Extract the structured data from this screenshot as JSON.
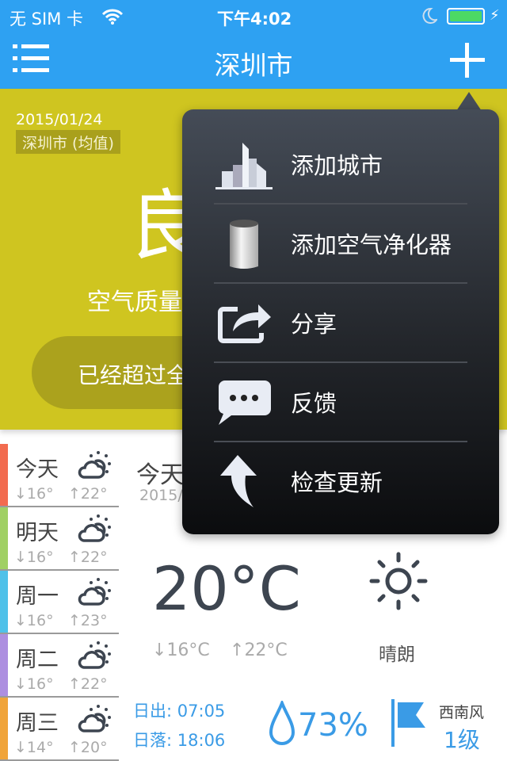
{
  "status_bar": {
    "carrier": "无 SIM 卡",
    "time": "下午4:02",
    "battery_color": "#4cd964"
  },
  "header": {
    "title": "深圳市",
    "menu_icon": "list-icon",
    "add_icon": "plus-icon"
  },
  "aqi": {
    "date": "2015/01/24",
    "location": "深圳市 (均值)",
    "level": "良",
    "description": "空气质量",
    "ranking": "已经超过全",
    "color": "#cfc520"
  },
  "menu": {
    "items": [
      {
        "label": "添加城市",
        "icon": "city-buildings-icon"
      },
      {
        "label": "添加空气净化器",
        "icon": "air-purifier-icon"
      },
      {
        "label": "分享",
        "icon": "share-icon"
      },
      {
        "label": "反馈",
        "icon": "chat-bubble-icon"
      },
      {
        "label": "检查更新",
        "icon": "up-arrow-icon"
      }
    ]
  },
  "forecast": [
    {
      "day": "今天",
      "low": "16°",
      "high": "22°",
      "color": "#f26b4f"
    },
    {
      "day": "明天",
      "low": "16°",
      "high": "22°",
      "color": "#a0d064"
    },
    {
      "day": "周一",
      "low": "16°",
      "high": "23°",
      "color": "#4fc1e9"
    },
    {
      "day": "周二",
      "low": "16°",
      "high": "22°",
      "color": "#ad8fe0"
    },
    {
      "day": "周三",
      "low": "14°",
      "high": "20°",
      "color": "#f0a43a"
    }
  ],
  "detail": {
    "day": "今天",
    "date": "2015/",
    "temp": "20°C",
    "low": "16°C",
    "high": "22°C",
    "condition": "晴朗",
    "sunrise_label": "日出:",
    "sunrise": "07:05",
    "sunset_label": "日落:",
    "sunset": "18:06",
    "humidity": "73%",
    "wind_dir": "西南风",
    "wind_level": "1级"
  }
}
